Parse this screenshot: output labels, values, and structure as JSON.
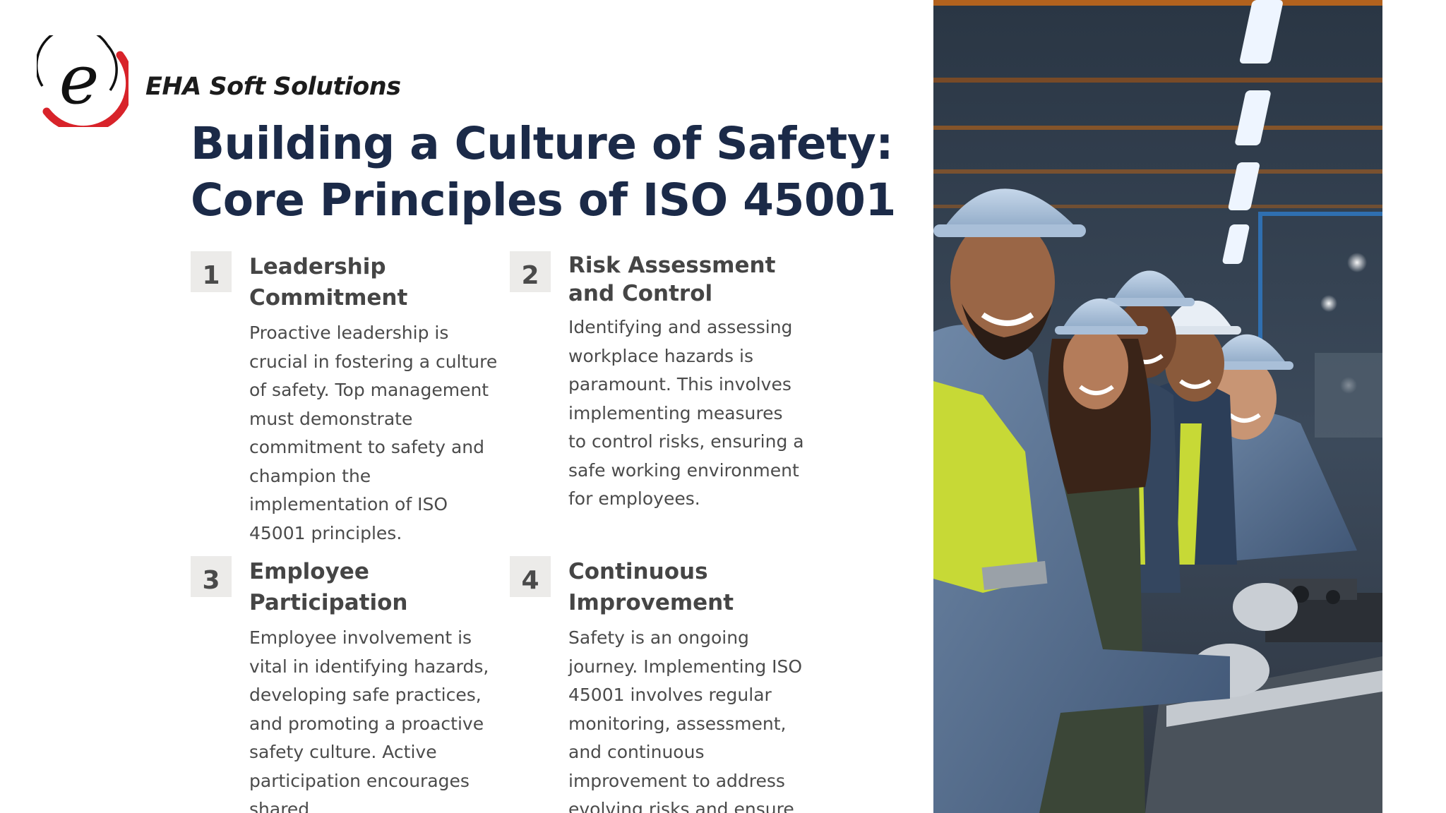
{
  "brand": {
    "name": "EHA Soft Solutions",
    "logo_letter": "e",
    "colors": {
      "ring_red": "#d8232a",
      "ring_black": "#111111"
    }
  },
  "title": {
    "line1": "Building a Culture of Safety:",
    "line2": "Core Principles of ISO 45001"
  },
  "principles": [
    {
      "number": "1",
      "heading": "Leadership Commitment",
      "text": "Proactive leadership is crucial in fostering a culture of safety. Top management must demonstrate commitment to safety and champion the implementation of ISO 45001 principles."
    },
    {
      "number": "2",
      "heading": "Risk Assessment and Control",
      "text": "Identifying and assessing workplace hazards is paramount. This involves implementing measures to control risks, ensuring a safe working environment for employees."
    },
    {
      "number": "3",
      "heading": "Employee Participation",
      "text": "Employee involvement is vital in identifying hazards, developing safe practices, and promoting a proactive safety culture. Active participation encourages shared"
    },
    {
      "number": "4",
      "heading": "Continuous Improvement",
      "text": "Safety is an ongoing journey. Implementing ISO 45001 involves regular monitoring, assessment, and continuous improvement to address evolving risks and ensure sustained safety"
    }
  ],
  "colors": {
    "title": "#1b2a48",
    "heading": "#454545",
    "body_text": "#4b4b4b",
    "number_box": "#ecebe9",
    "vest": "#c7d936",
    "hardhat": "#9fb9d6"
  },
  "photo": {
    "subject": "smiling workers in hard hats and high-visibility vests in a factory"
  }
}
